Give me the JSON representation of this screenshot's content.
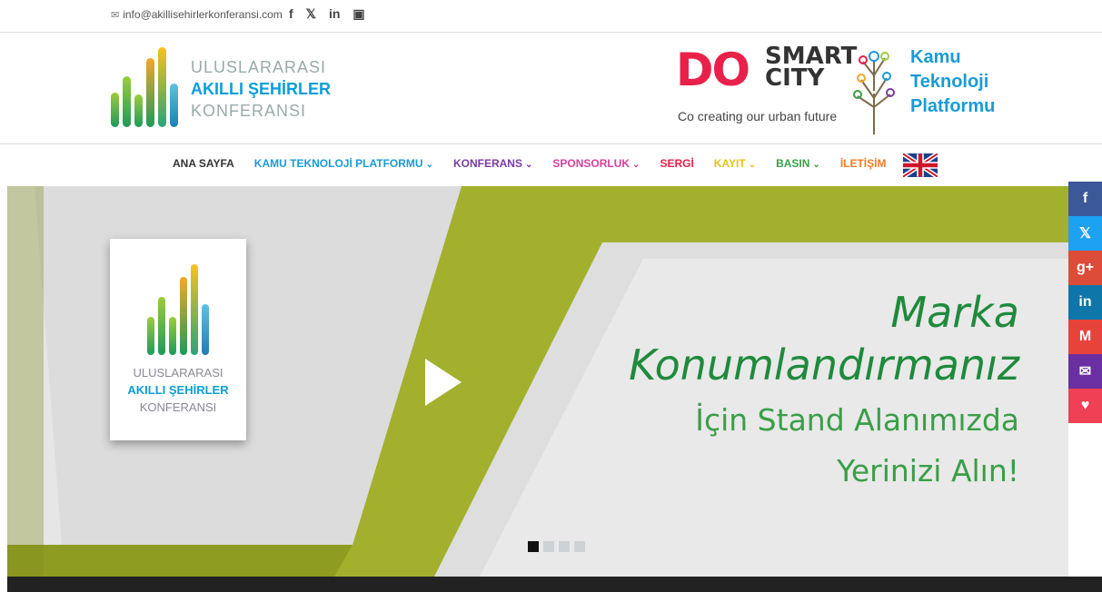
{
  "topbar": {
    "email": "info@akillisehirlerkonferansi.com",
    "social": [
      "f",
      "𝕏",
      "in",
      "▣"
    ]
  },
  "logo": {
    "line1": "ULUSLARARASI",
    "line2": "AKILLI ŞEHİRLER",
    "line3": "KONFERANSI"
  },
  "partner": {
    "do": "DO",
    "smart1": "SMART",
    "smart2": "CITY",
    "tagline": "Co creating our urban future",
    "kamu1": "Kamu",
    "kamu2": "Teknoloji",
    "kamu3": "Platformu"
  },
  "nav": [
    {
      "label": "ANA SAYFA",
      "color": "#333333",
      "dropdown": false
    },
    {
      "label": "KAMU TEKNOLOJİ PLATFORMU",
      "color": "#1a9bd7",
      "dropdown": true
    },
    {
      "label": "KONFERANS",
      "color": "#7b3aa0",
      "dropdown": true
    },
    {
      "label": "SPONSORLUK",
      "color": "#d63f9b",
      "dropdown": true
    },
    {
      "label": "SERGİ",
      "color": "#e8204a",
      "dropdown": false
    },
    {
      "label": "KAYIT",
      "color": "#e8c21a",
      "dropdown": true
    },
    {
      "label": "BASIN",
      "color": "#3a9e48",
      "dropdown": true
    },
    {
      "label": "İLETİŞİM",
      "color": "#f07b2a",
      "dropdown": false
    }
  ],
  "hero": {
    "logo_line1": "ULUSLARARASI",
    "logo_line2": "AKILLI ŞEHİRLER",
    "logo_line3": "KONFERANSI",
    "slogan1": "Marka",
    "slogan2": "Konumlandırmanız",
    "slogan3": "İçin Stand Alanımızda",
    "slogan4": "Yerinizi Alın!",
    "slide_count": 4,
    "active_slide": 1
  },
  "share_sidebar": [
    {
      "icon": "facebook-icon",
      "glyph": "f",
      "color": "#3b5998"
    },
    {
      "icon": "twitter-icon",
      "glyph": "𝕏",
      "color": "#1da1f2"
    },
    {
      "icon": "google-plus-icon",
      "glyph": "g+",
      "color": "#dd4b39"
    },
    {
      "icon": "linkedin-icon",
      "glyph": "in",
      "color": "#0e76a8"
    },
    {
      "icon": "gmail-icon",
      "glyph": "M",
      "color": "#e8433a"
    },
    {
      "icon": "email-icon",
      "glyph": "✉",
      "color": "#6a2fa0"
    },
    {
      "icon": "pocket-icon",
      "glyph": "♥",
      "color": "#ef4056"
    }
  ],
  "colors": {
    "hero_olive": "#a2b02e",
    "slogan_green": "#1f8a3c",
    "accent_blue": "#0a9fd9"
  }
}
